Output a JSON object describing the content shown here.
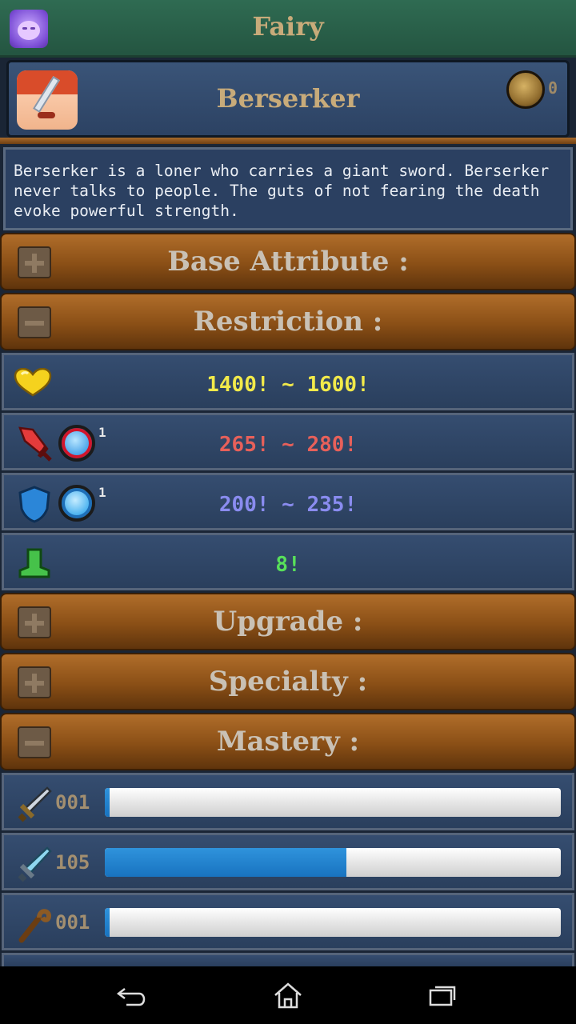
{
  "header": {
    "title": "Fairy",
    "avatar_icon": "fairy-avatar-icon"
  },
  "character": {
    "name": "Berserker",
    "portrait_icon": "berserker-portrait-icon",
    "coin_icon": "coin-icon",
    "coins": "0"
  },
  "description": "Berserker is a loner who carries a giant sword. Berserker never talks to people. The guts of not fearing the death evoke powerful strength.",
  "sections": {
    "base_attribute": {
      "label": "Base Attribute :",
      "state": "collapsed"
    },
    "restriction": {
      "label": "Restriction :",
      "state": "expanded"
    },
    "upgrade": {
      "label": "Upgrade :",
      "state": "collapsed"
    },
    "specialty": {
      "label": "Specialty :",
      "state": "collapsed"
    },
    "mastery": {
      "label": "Mastery :",
      "state": "expanded"
    }
  },
  "restriction_rows": [
    {
      "icon": "heart-icon",
      "value": "1400!  ~ 1600!",
      "color": "#f2ea4a"
    },
    {
      "icon": "attack-icon",
      "gem_icon": "red-gem-icon",
      "gem_count": "1",
      "value": "265!  ~ 280!",
      "color": "#e8605a"
    },
    {
      "icon": "shield-icon",
      "gem_icon": "blue-gem-icon",
      "gem_count": "1",
      "value": "200!  ~ 235!",
      "color": "#8a8cf0"
    },
    {
      "icon": "boot-icon",
      "value": "8!",
      "color": "#58e05a"
    }
  ],
  "mastery_rows": [
    {
      "icon": "sword-icon",
      "level": "001",
      "progress": 0.01
    },
    {
      "icon": "blue-sword-icon",
      "level": "105",
      "progress": 0.53
    },
    {
      "icon": "staff-icon",
      "level": "001",
      "progress": 0.01
    }
  ],
  "navbar": {
    "back_icon": "back-icon",
    "home_icon": "home-icon",
    "recents_icon": "recents-icon"
  }
}
